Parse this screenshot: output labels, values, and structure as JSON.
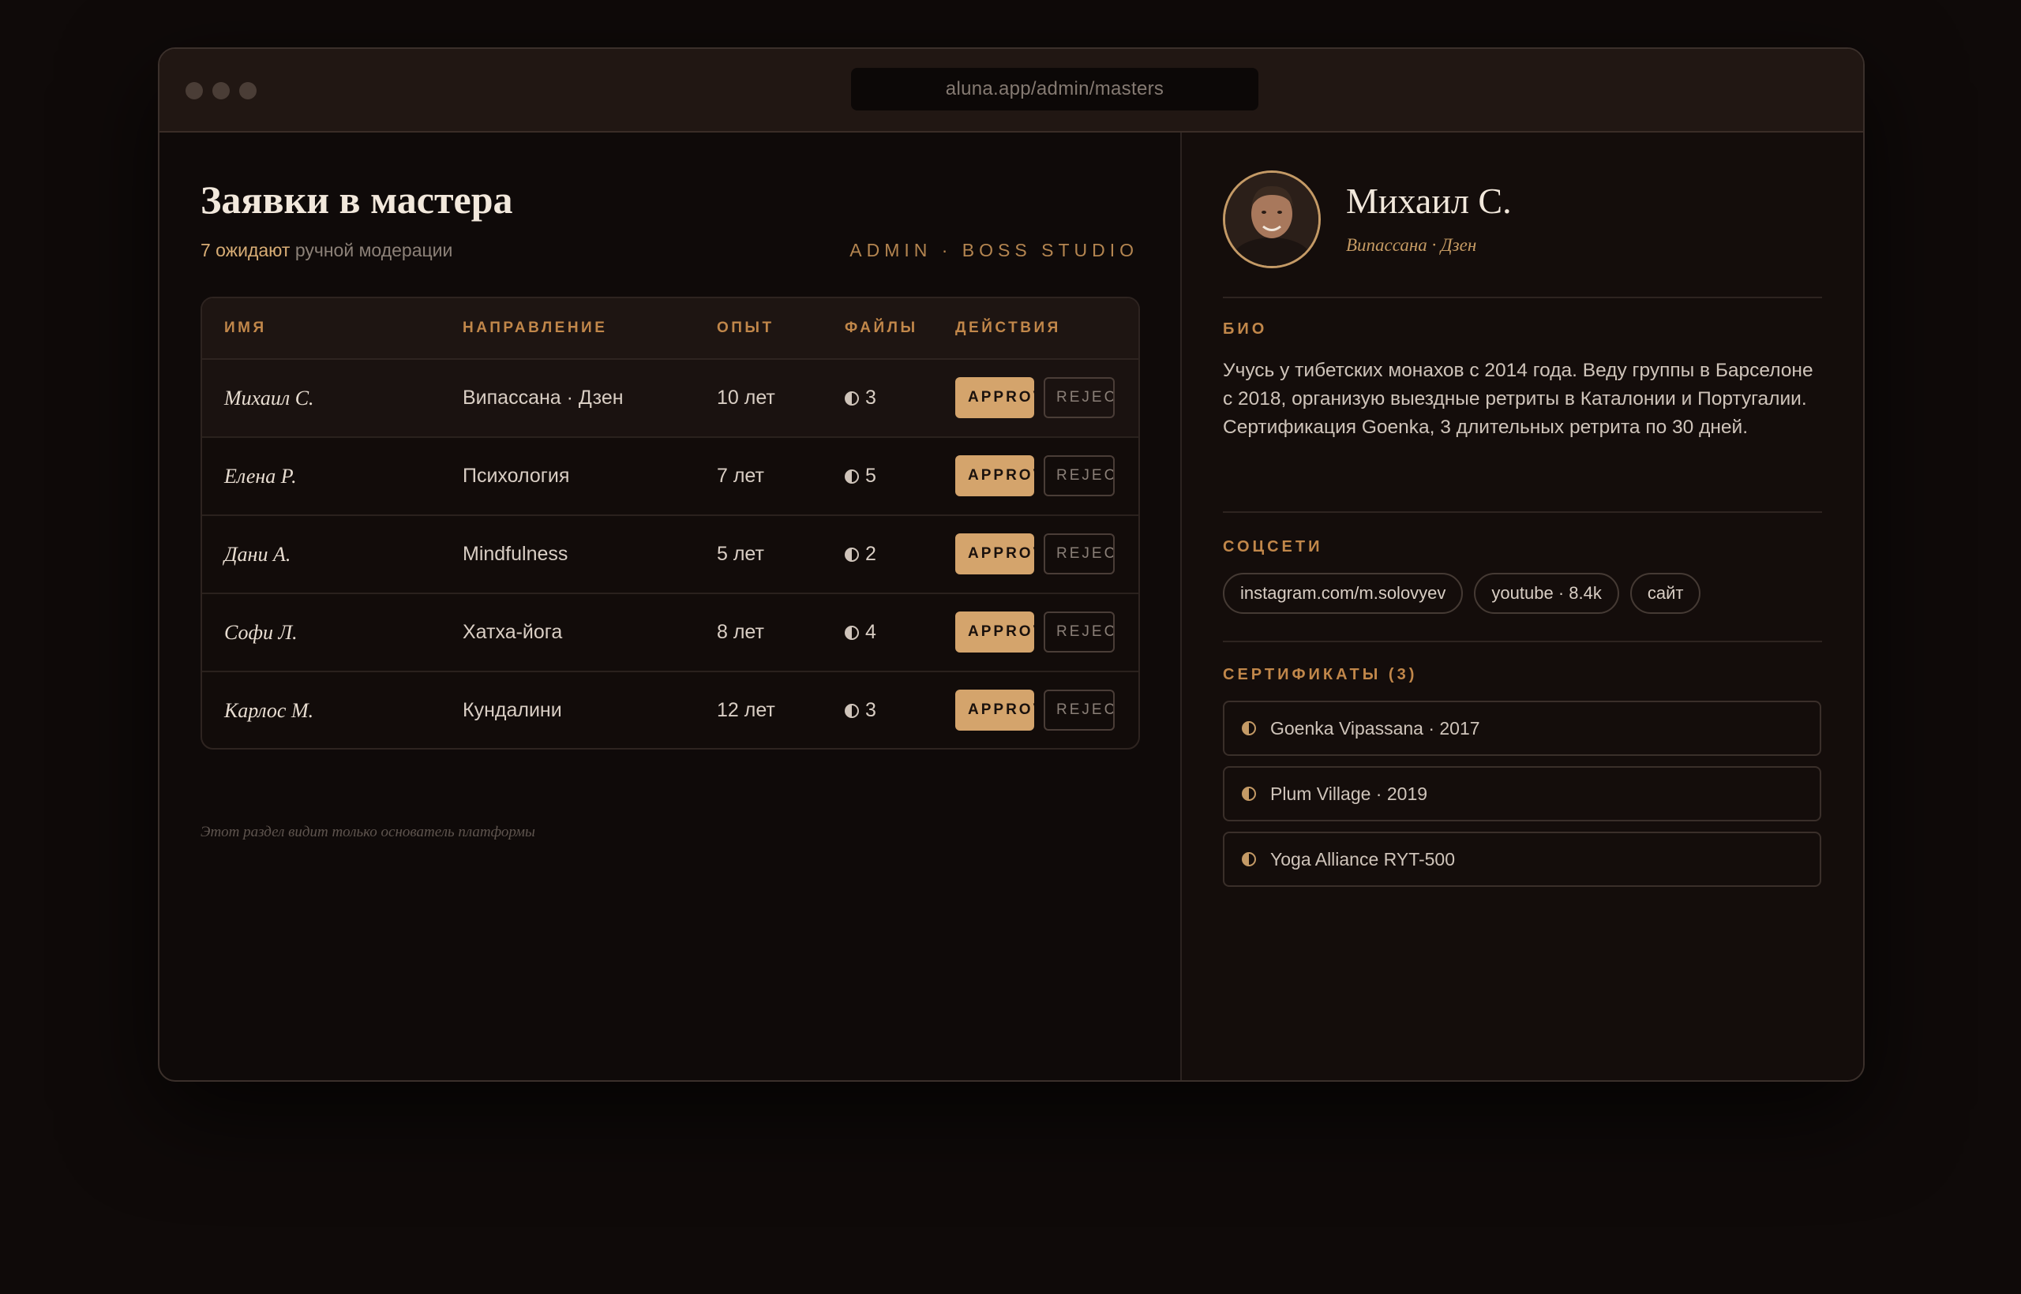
{
  "browser": {
    "url": "aluna.app/admin/masters"
  },
  "page": {
    "title": "Заявки в мастера",
    "pending_count": "7 ожидают",
    "pending_suffix": " ручной модерации",
    "admin_tag": "ADMIN · BOSS STUDIO",
    "footnote": "Этот раздел видит только основатель платформы"
  },
  "table": {
    "headers": {
      "name": "ИМЯ",
      "direction": "НАПРАВЛЕНИЕ",
      "experience": "ОПЫТ",
      "files": "ФАЙЛЫ",
      "actions": "ДЕЙСТВИЯ"
    },
    "approve_label": "APPROVE",
    "reject_label": "REJECT",
    "rows": [
      {
        "name": "Михаил С.",
        "direction": "Випассана · Дзен",
        "experience": "10 лет",
        "files": "3"
      },
      {
        "name": "Елена Р.",
        "direction": "Психология",
        "experience": "7 лет",
        "files": "5"
      },
      {
        "name": "Дани А.",
        "direction": "Mindfulness",
        "experience": "5 лет",
        "files": "2"
      },
      {
        "name": "Софи Л.",
        "direction": "Хатха-йога",
        "experience": "8 лет",
        "files": "4"
      },
      {
        "name": "Карлос М.",
        "direction": "Кундалини",
        "experience": "12 лет",
        "files": "3"
      }
    ]
  },
  "profile": {
    "name": "Михаил С.",
    "direction": "Випассана · Дзен",
    "bio_label": "БИО",
    "bio": "Учусь у тибетских монахов с 2014 года. Веду группы в Барселоне с 2018, организую выездные ретриты в Каталонии и Португалии. Сертификация Goenka, 3 длительных ретрита по 30 дней.",
    "social_label": "СОЦСЕТИ",
    "socials": [
      "instagram.com/m.solovyev",
      "youtube · 8.4k",
      "сайт"
    ],
    "certs_label": "СЕРТИФИКАТЫ (3)",
    "certs": [
      "Goenka Vipassana · 2017",
      "Plum Village · 2019",
      "Yoga Alliance RYT-500"
    ]
  },
  "colors": {
    "accent": "#d4a46c",
    "background": "#0f0a09",
    "panel": "#140d0b"
  }
}
